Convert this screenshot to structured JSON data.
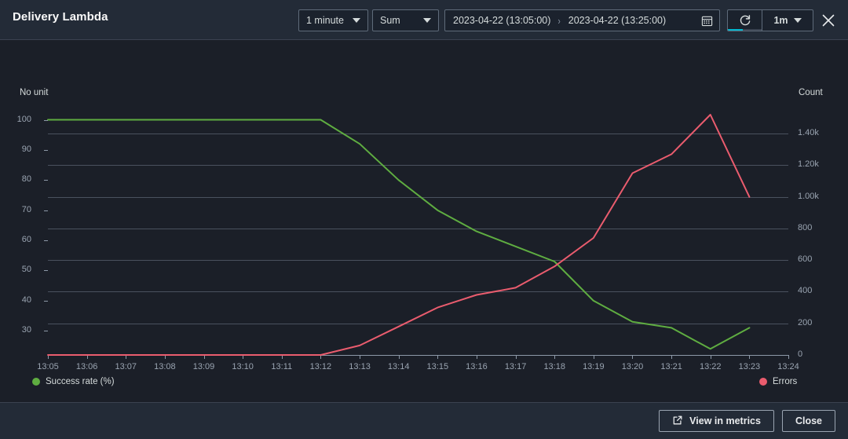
{
  "header": {
    "title": "Delivery Lambda",
    "period": {
      "label": "1 minute",
      "icon": "chevron-down-icon"
    },
    "statistic": {
      "label": "Sum",
      "icon": "chevron-down-icon"
    },
    "range": {
      "start": "2023-04-22 (13:05:00)",
      "separator": "›",
      "end": "2023-04-22 (13:25:00)",
      "icon": "calendar-icon"
    },
    "refresh": {
      "icon": "refresh-icon",
      "progress_percent": 45
    },
    "interval": {
      "label": "1m",
      "icon": "chevron-down-icon"
    },
    "close": {
      "icon": "close-icon"
    },
    "accent_color": "#00b8d0"
  },
  "footer": {
    "view_in_metrics": {
      "label": "View in metrics",
      "icon": "external-link-icon"
    },
    "close": {
      "label": "Close"
    }
  },
  "chart_data": {
    "type": "line",
    "title": "",
    "xlabel": "",
    "ylabel": "No unit",
    "y2label": "Count",
    "grid": true,
    "legend_position": "bottom",
    "x": [
      "13:05",
      "13:06",
      "13:07",
      "13:08",
      "13:09",
      "13:10",
      "13:11",
      "13:12",
      "13:13",
      "13:14",
      "13:15",
      "13:16",
      "13:17",
      "13:18",
      "13:19",
      "13:20",
      "13:21",
      "13:22",
      "13:23"
    ],
    "xticks": [
      "13:05",
      "13:06",
      "13:07",
      "13:08",
      "13:09",
      "13:10",
      "13:11",
      "13:12",
      "13:13",
      "13:14",
      "13:15",
      "13:16",
      "13:17",
      "13:18",
      "13:19",
      "13:20",
      "13:21",
      "13:22",
      "13:23",
      "13:24"
    ],
    "yticks_left": [
      100,
      90,
      80,
      70,
      60,
      50,
      40,
      30
    ],
    "ylim": [
      22,
      103
    ],
    "yticks_right": [
      "1.40k",
      "1.20k",
      "1.00k",
      "800",
      "600",
      "400",
      "200",
      "0"
    ],
    "yticks_right_values": [
      1400,
      1200,
      1000,
      800,
      600,
      400,
      200,
      0
    ],
    "y2lim": [
      0,
      1545
    ],
    "series": [
      {
        "name": "Success rate (%)",
        "axis": "left",
        "color": "#5fad41",
        "values": [
          100,
          100,
          100,
          100,
          100,
          100,
          100,
          100,
          92,
          80,
          70,
          63,
          58,
          53,
          40,
          33,
          31,
          24,
          31
        ]
      },
      {
        "name": "Errors",
        "axis": "right",
        "color": "#ea5c6e",
        "values": [
          0,
          0,
          0,
          0,
          0,
          0,
          0,
          0,
          60,
          180,
          300,
          380,
          425,
          560,
          740,
          1150,
          1270,
          1520,
          1000
        ]
      }
    ]
  }
}
